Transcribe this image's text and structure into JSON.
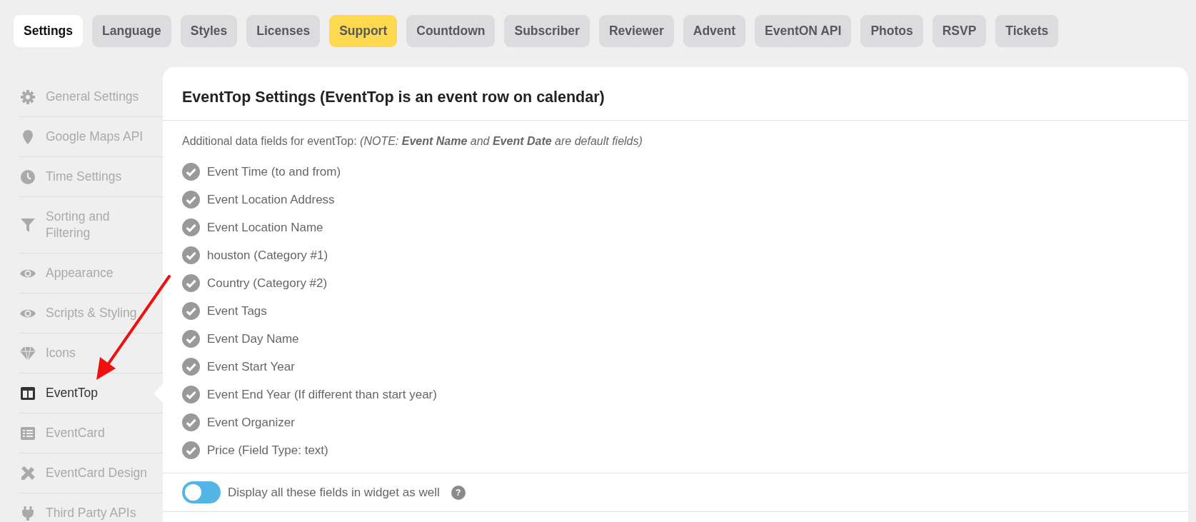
{
  "tabs": [
    {
      "label": "Settings",
      "selected": true,
      "highlighted": false
    },
    {
      "label": "Language",
      "selected": false,
      "highlighted": false
    },
    {
      "label": "Styles",
      "selected": false,
      "highlighted": false
    },
    {
      "label": "Licenses",
      "selected": false,
      "highlighted": false
    },
    {
      "label": "Support",
      "selected": false,
      "highlighted": true
    },
    {
      "label": "Countdown",
      "selected": false,
      "highlighted": false
    },
    {
      "label": "Subscriber",
      "selected": false,
      "highlighted": false
    },
    {
      "label": "Reviewer",
      "selected": false,
      "highlighted": false
    },
    {
      "label": "Advent",
      "selected": false,
      "highlighted": false
    },
    {
      "label": "EventON API",
      "selected": false,
      "highlighted": false
    },
    {
      "label": "Photos",
      "selected": false,
      "highlighted": false
    },
    {
      "label": "RSVP",
      "selected": false,
      "highlighted": false
    },
    {
      "label": "Tickets",
      "selected": false,
      "highlighted": false
    }
  ],
  "sidebar": {
    "items": [
      {
        "label": "General Settings",
        "selected": false
      },
      {
        "label": "Google Maps API",
        "selected": false
      },
      {
        "label": "Time Settings",
        "selected": false
      },
      {
        "label": "Sorting and Filtering",
        "selected": false
      },
      {
        "label": "Appearance",
        "selected": false
      },
      {
        "label": "Scripts & Styling",
        "selected": false
      },
      {
        "label": "Icons",
        "selected": false
      },
      {
        "label": "EventTop",
        "selected": true
      },
      {
        "label": "EventCard",
        "selected": false
      },
      {
        "label": "EventCard Design",
        "selected": false
      },
      {
        "label": "Third Party APIs",
        "selected": false
      }
    ]
  },
  "panel": {
    "title": "EventTop Settings (EventTop is an event row on calendar)",
    "note": "Additional data fields for eventTop: *(NOTE:* **Event Name** *and* **Event Date** *are default fields)*",
    "fields": [
      {
        "label": "Event Time (to and from)",
        "checked": true
      },
      {
        "label": "Event Location Address",
        "checked": true
      },
      {
        "label": "Event Location Name",
        "checked": true
      },
      {
        "label": "houston (Category #1)",
        "checked": true
      },
      {
        "label": "Country (Category #2)",
        "checked": true
      },
      {
        "label": "Event Tags",
        "checked": true
      },
      {
        "label": "Event Day Name",
        "checked": true
      },
      {
        "label": "Event Start Year",
        "checked": true
      },
      {
        "label": "Event End Year (If different than start year)",
        "checked": true
      },
      {
        "label": "Event Organizer",
        "checked": true
      },
      {
        "label": "Price (Field Type: text)",
        "checked": true
      }
    ],
    "widget_toggle": {
      "label": "Display all these fields in widget as well",
      "on": false,
      "help": "?"
    }
  }
}
